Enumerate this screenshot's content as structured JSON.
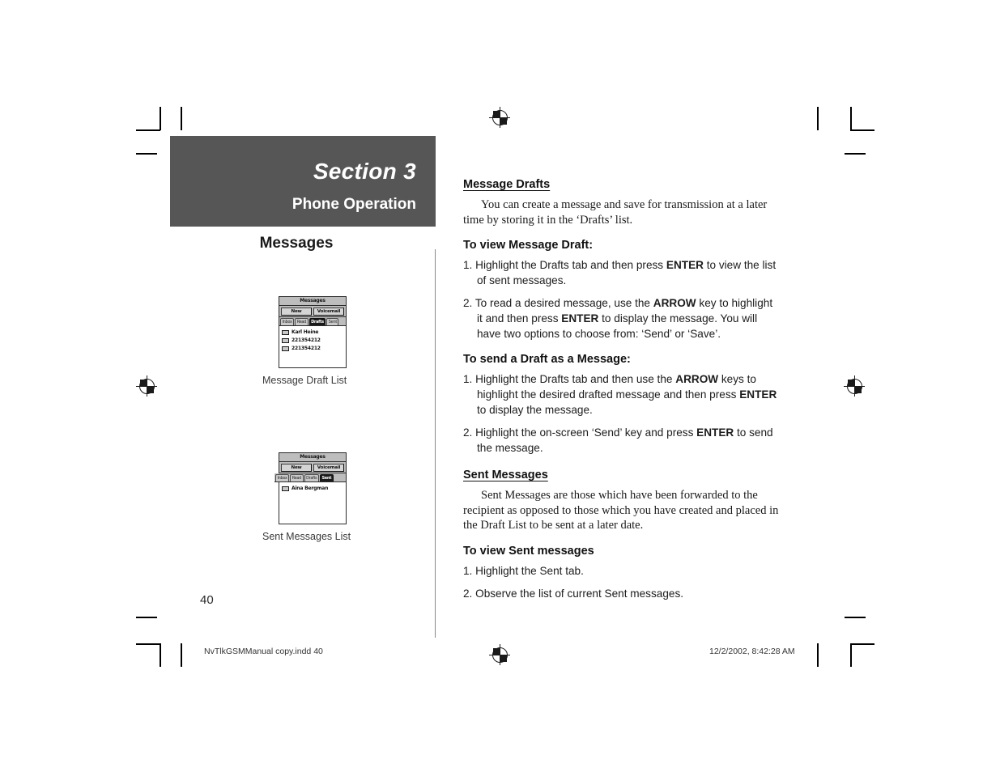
{
  "section": {
    "title": "Section 3",
    "subtitle": "Phone Operation",
    "block_color": "#565656"
  },
  "left_column": {
    "heading": "Messages",
    "figures": [
      {
        "caption": "Message Draft List",
        "screen": {
          "title": "Messages",
          "buttons": [
            "New",
            "Voicemail"
          ],
          "tabs": [
            {
              "label": "Inbox",
              "selected": false
            },
            {
              "label": "Read",
              "selected": false
            },
            {
              "label": "Drafts",
              "selected": true
            },
            {
              "label": "Sent",
              "selected": false
            }
          ],
          "rows": [
            "Karl Heine",
            "221354212",
            "221354212"
          ]
        }
      },
      {
        "caption": "Sent Messages List",
        "screen": {
          "title": "Messages",
          "buttons": [
            "New",
            "Voicemail"
          ],
          "tabs": [
            {
              "label": "Inbox",
              "selected": false
            },
            {
              "label": "Read",
              "selected": false
            },
            {
              "label": "Drafts",
              "selected": false
            },
            {
              "label": "Sent",
              "selected": true
            }
          ],
          "rows": [
            "Aina Bergman"
          ]
        }
      }
    ]
  },
  "right_column": {
    "blocks": [
      {
        "type": "heading_underline",
        "text": "Message Drafts"
      },
      {
        "type": "paragraph",
        "text": "You can create a message and save for transmission at a later time by storing it in the ‘Drafts’ list."
      },
      {
        "type": "heading_bold",
        "text": "To view Message Draft:"
      },
      {
        "type": "step",
        "number": "1.",
        "parts": [
          {
            "t": "Highlight the Drafts tab and then press "
          },
          {
            "t": "ENTER",
            "b": true
          },
          {
            "t": " to view the list of sent messages."
          }
        ]
      },
      {
        "type": "step",
        "number": "2.",
        "parts": [
          {
            "t": "To read a desired message, use the "
          },
          {
            "t": "ARROW",
            "b": true
          },
          {
            "t": " key to highlight it and then press "
          },
          {
            "t": "ENTER",
            "b": true
          },
          {
            "t": " to display the message. You will have two options to choose from: ‘Send’ or ‘Save’."
          }
        ]
      },
      {
        "type": "heading_bold",
        "text": "To send a Draft as a Message:"
      },
      {
        "type": "step",
        "number": "1.",
        "parts": [
          {
            "t": "Highlight the Drafts tab and then use the "
          },
          {
            "t": "ARROW",
            "b": true
          },
          {
            "t": " keys to highlight the desired drafted message and then press "
          },
          {
            "t": "ENTER",
            "b": true
          },
          {
            "t": " to display the message."
          }
        ]
      },
      {
        "type": "step",
        "number": "2.",
        "parts": [
          {
            "t": "Highlight the on-screen ‘Send’ key and press "
          },
          {
            "t": "ENTER",
            "b": true
          },
          {
            "t": " to send the message."
          }
        ]
      },
      {
        "type": "heading_underline",
        "text": "Sent Messages"
      },
      {
        "type": "paragraph",
        "text": "Sent Messages are those which have been forwarded to the recipient as opposed to those which you have created and placed in the Draft List to be sent at a later date."
      },
      {
        "type": "heading_bold",
        "text": "To view Sent messages"
      },
      {
        "type": "step",
        "number": "1.",
        "parts": [
          {
            "t": "Highlight the Sent tab."
          }
        ]
      },
      {
        "type": "step",
        "number": "2.",
        "parts": [
          {
            "t": "Observe the list of current Sent messages."
          }
        ]
      }
    ]
  },
  "page_number": "40",
  "footer": {
    "file": "NvTlkGSMManual copy.indd   40",
    "timestamp": "12/2/2002, 8:42:28 AM"
  }
}
